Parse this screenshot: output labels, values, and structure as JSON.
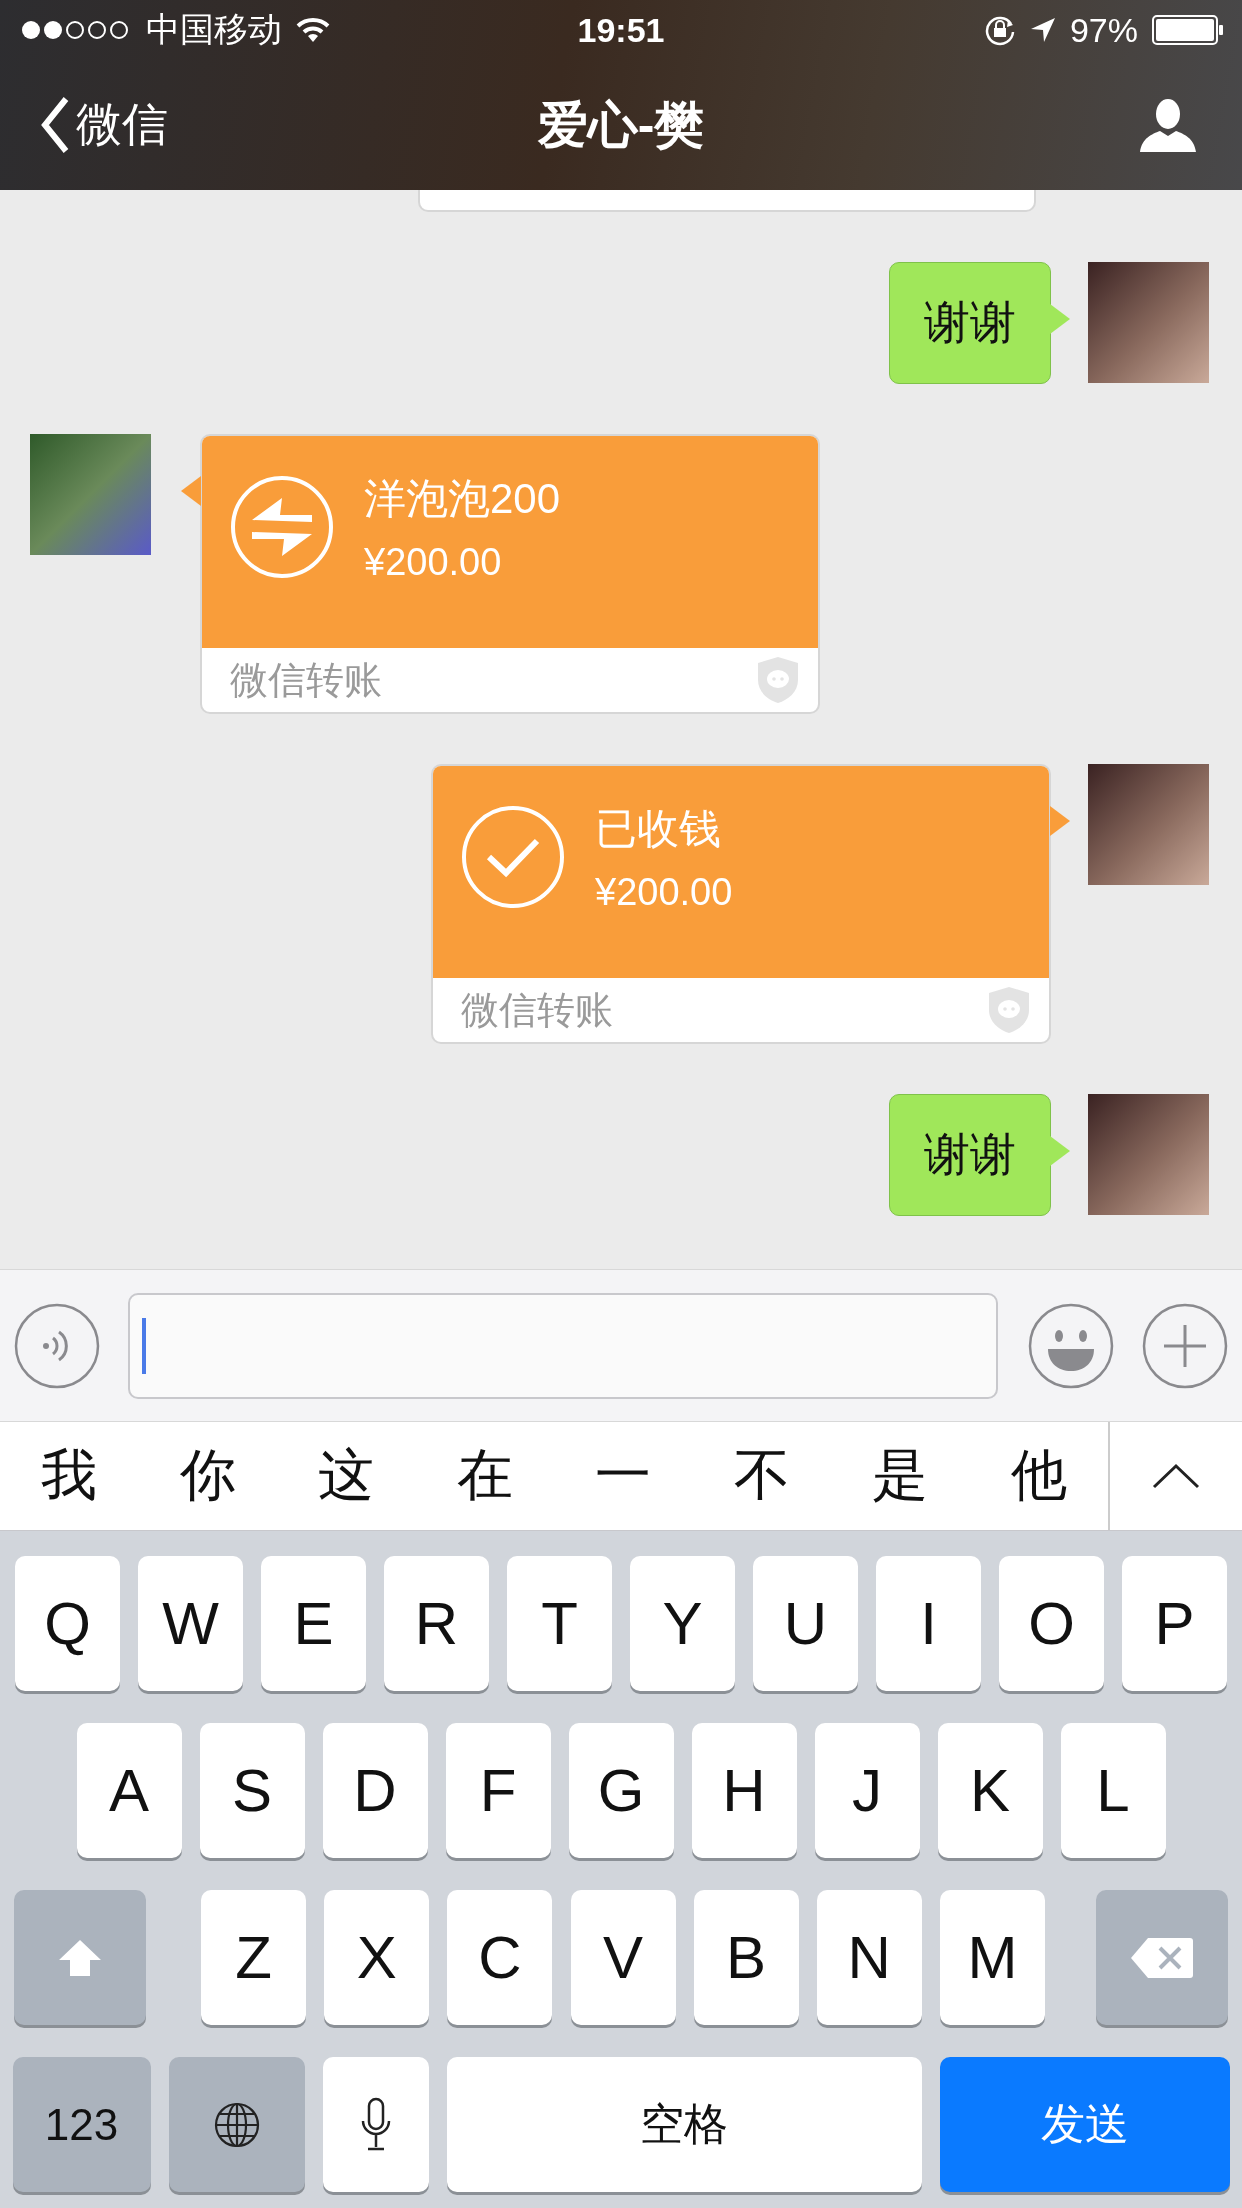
{
  "status_bar": {
    "carrier": "中国移动",
    "time": "19:51",
    "battery": "97%"
  },
  "nav": {
    "back": "微信",
    "title": "爱心-樊"
  },
  "messages": [
    {
      "kind": "edge",
      "incoming": false
    },
    {
      "kind": "text",
      "incoming": false,
      "text": "谢谢"
    },
    {
      "kind": "transfer",
      "incoming": true,
      "title": "洋泡泡200",
      "amount": "¥200.00",
      "footer": "微信转账"
    },
    {
      "kind": "receipt",
      "incoming": false,
      "title": "已收钱",
      "amount": "¥200.00",
      "footer": "微信转账"
    },
    {
      "kind": "text",
      "incoming": false,
      "text": "谢谢"
    }
  ],
  "candidates": [
    "我",
    "你",
    "这",
    "在",
    "一",
    "不",
    "是",
    "他"
  ],
  "keyboard": {
    "letter_rows": [
      [
        "Q",
        "W",
        "E",
        "R",
        "T",
        "Y",
        "U",
        "I",
        "O",
        "P"
      ],
      [
        "A",
        "S",
        "D",
        "F",
        "G",
        "H",
        "J",
        "K",
        "L"
      ],
      [
        "Z",
        "X",
        "C",
        "V",
        "B",
        "N",
        "M"
      ]
    ],
    "numbers_key": "123",
    "space_key": "空格",
    "send_key": "发送"
  }
}
